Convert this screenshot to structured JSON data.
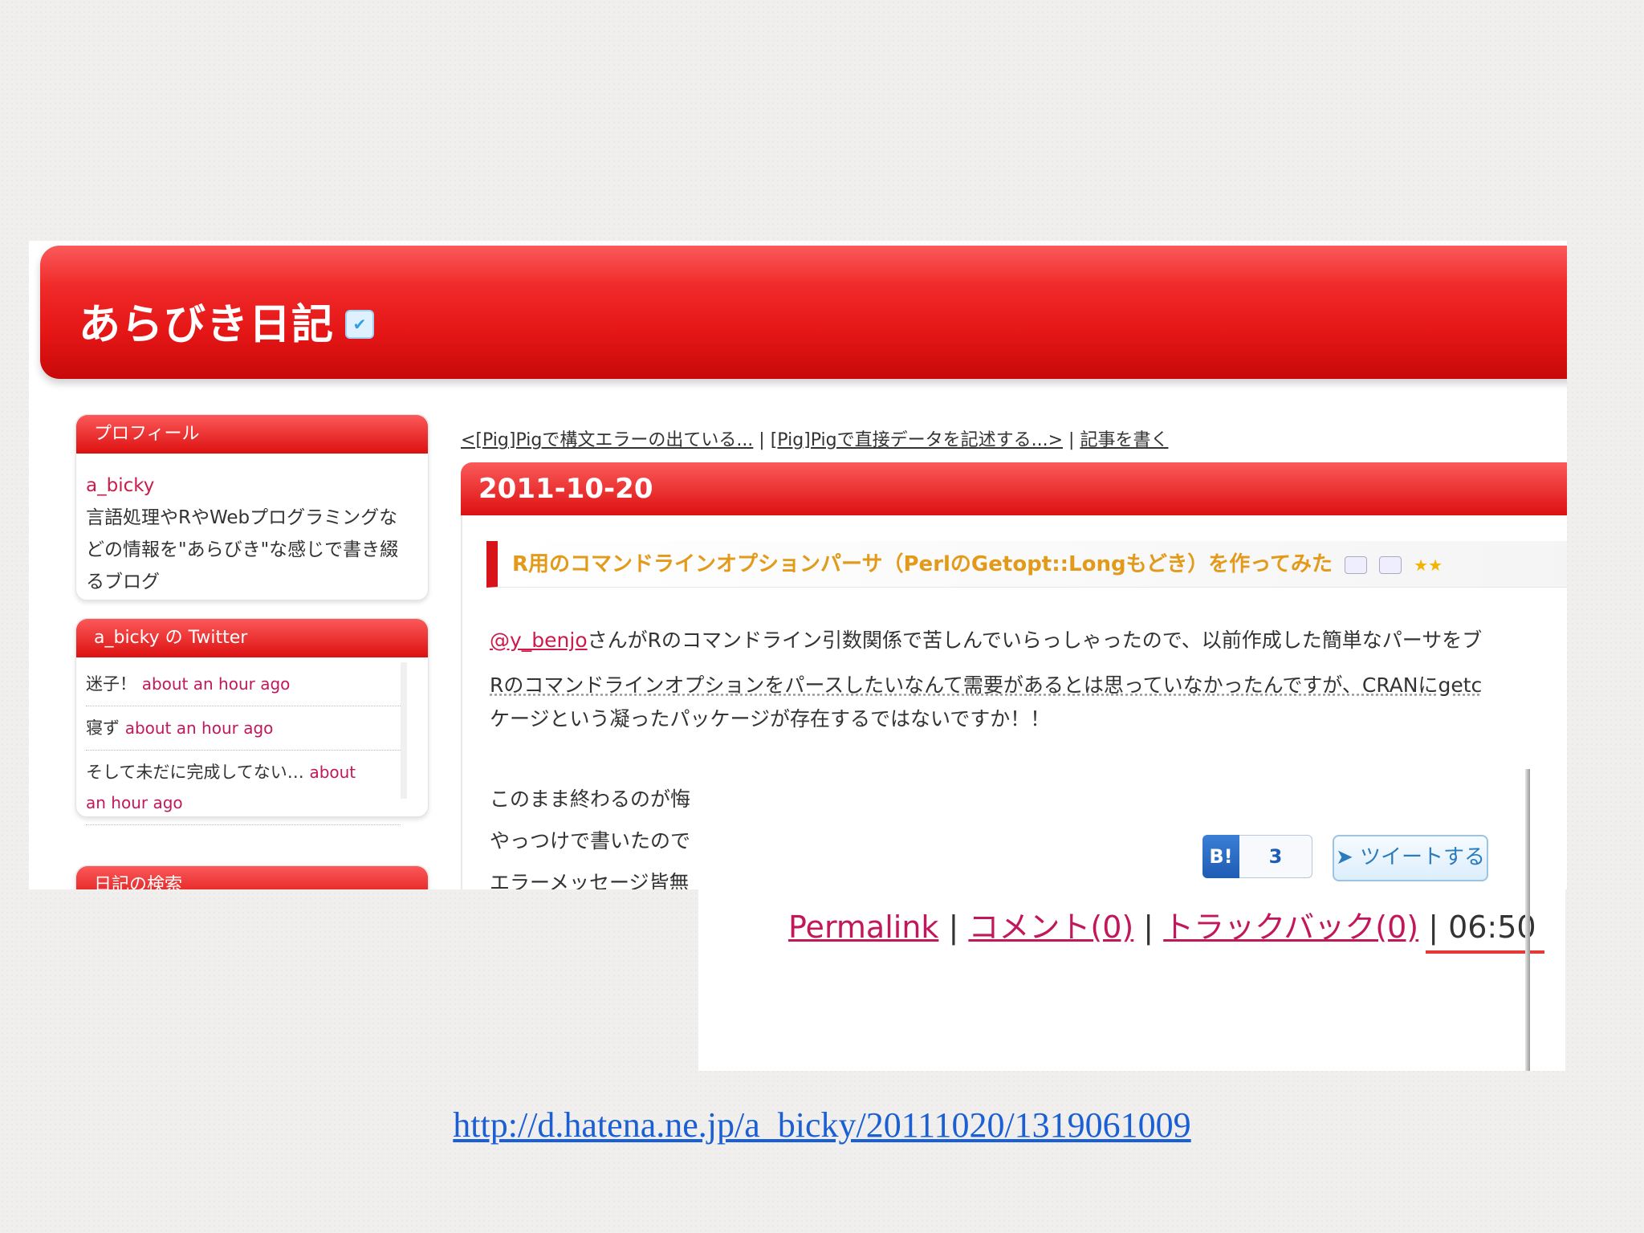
{
  "blog": {
    "title": "あらびき日記",
    "twitter_icon": "twitter-bird-icon"
  },
  "sidebar": {
    "profile": {
      "header": "プロフィール",
      "name": "a_bicky",
      "lines": [
        "言語処理やRやWebプログラミングな",
        "どの情報を\"あらびき\"な感じで書き綴",
        "るブログ"
      ]
    },
    "twitter": {
      "header": "a_bicky の Twitter",
      "items": [
        {
          "text": "迷子！",
          "time": "about an hour ago"
        },
        {
          "text": "寝ず",
          "time": "about an hour ago"
        },
        {
          "text": "そして未だに完成してない…",
          "time": "about",
          "time2": "an hour ago"
        }
      ]
    },
    "search": {
      "header": "日記の検索"
    }
  },
  "nav": {
    "prev": "<[Pig]Pigで構文エラーの出ている...",
    "sep1": " | ",
    "next": "[Pig]Pigで直接データを記述する...>",
    "sep2": " | ",
    "write": "記事を書く"
  },
  "entry": {
    "date": "2011-10-20",
    "title": "R用のコマンドラインオプションパーサ（PerlのGetopt::Longもどき）を作ってみた",
    "stars": "★★",
    "p1_link": "@y_benjo",
    "p1_rest": "さんがRのコマンドライン引数関係で苦しんでいらっしゃったので、以前作成した簡単なパーサをブ",
    "p2_line1": "Rのコマンドラインオプションをパースしたいなんて需要があるとは思っていなかったんですが、CRANにgetc",
    "p2_line2": "ケージという凝ったパッケージが存在するではないですか！！",
    "p3_line1": "このまま終わるのが悔",
    "p3_line2": "やっつけで書いたので",
    "p3_line3": "エラーメッセージ皆無"
  },
  "footer_zoom": {
    "hatena_label": "B!",
    "hatena_count": "3",
    "tweet_label": "ツイートする",
    "permalink": "Permalink",
    "sep": " | ",
    "comment": "コメント(0)",
    "trackback": "トラックバック(0)",
    "time": "06:50"
  },
  "caption": {
    "url": "http://d.hatena.ne.jp/a_bicky/20111020/1319061009"
  }
}
